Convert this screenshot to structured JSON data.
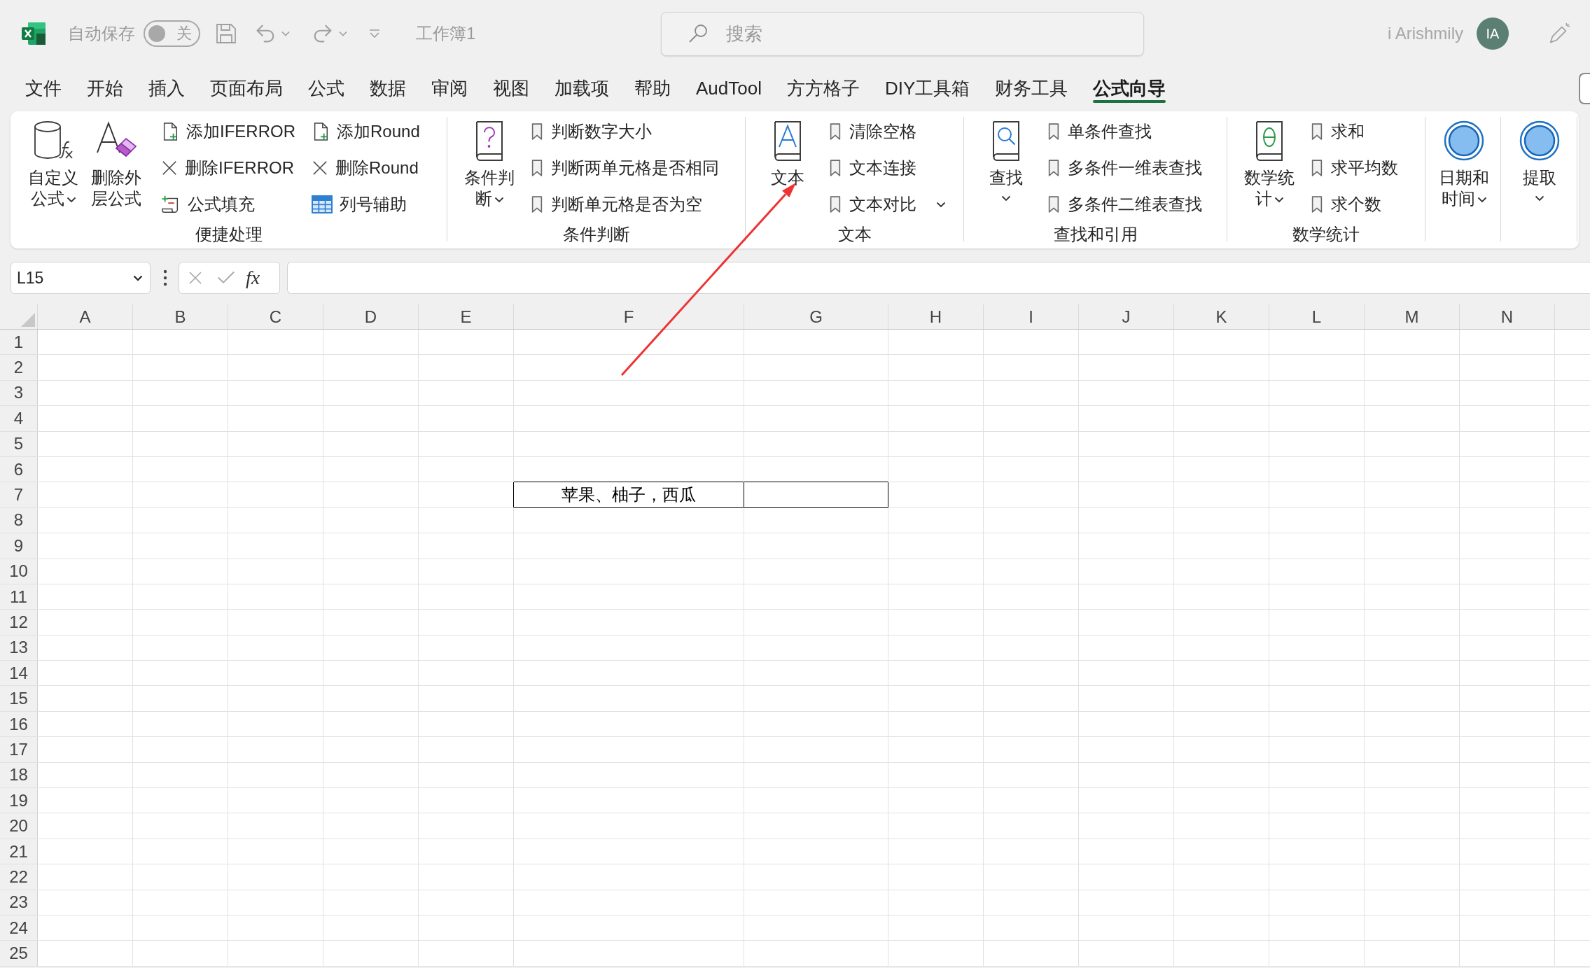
{
  "title_bar": {
    "autosave": {
      "label": "自动保存",
      "on": false,
      "state_text": "关"
    },
    "document_title": "工作簿1",
    "search": {
      "placeholder": "搜索"
    },
    "account": {
      "name": "i Arishmily",
      "initials": "IA"
    }
  },
  "ribbon_tabs": [
    {
      "label": "文件",
      "selected": false
    },
    {
      "label": "开始",
      "selected": false
    },
    {
      "label": "插入",
      "selected": false
    },
    {
      "label": "页面布局",
      "selected": false
    },
    {
      "label": "公式",
      "selected": false
    },
    {
      "label": "数据",
      "selected": false
    },
    {
      "label": "审阅",
      "selected": false
    },
    {
      "label": "视图",
      "selected": false
    },
    {
      "label": "加载项",
      "selected": false
    },
    {
      "label": "帮助",
      "selected": false
    },
    {
      "label": "AudTool",
      "selected": false
    },
    {
      "label": "方方格子",
      "selected": false
    },
    {
      "label": "DIY工具箱",
      "selected": false
    },
    {
      "label": "财务工具",
      "selected": false
    },
    {
      "label": "公式向导",
      "selected": true
    }
  ],
  "ribbon_groups": [
    {
      "label": "便捷处理",
      "items": [
        {
          "kind": "large",
          "label": "自定义公式",
          "has_menu": true
        },
        {
          "kind": "large",
          "label": "删除外层公式",
          "has_menu": false
        },
        {
          "kind": "stack",
          "buttons": [
            {
              "label": "添加IFERROR",
              "has_menu": false
            },
            {
              "label": "删除IFERROR",
              "has_menu": false
            },
            {
              "label": "公式填充",
              "has_menu": false
            }
          ]
        },
        {
          "kind": "stack",
          "buttons": [
            {
              "label": "添加Round",
              "has_menu": false
            },
            {
              "label": "删除Round",
              "has_menu": false
            },
            {
              "label": "列号辅助",
              "has_menu": false
            }
          ]
        }
      ]
    },
    {
      "label": "条件判断",
      "items": [
        {
          "kind": "large",
          "label": "条件判断",
          "has_menu": true
        },
        {
          "kind": "stack",
          "buttons": [
            {
              "label": "判断数字大小",
              "has_menu": false
            },
            {
              "label": "判断两单元格是否相同",
              "has_menu": false
            },
            {
              "label": "判断单元格是否为空",
              "has_menu": false
            }
          ]
        }
      ]
    },
    {
      "label": "文本",
      "items": [
        {
          "kind": "large",
          "label": "文本",
          "has_menu": false
        },
        {
          "kind": "stack",
          "buttons": [
            {
              "label": "清除空格",
              "has_menu": false
            },
            {
              "label": "文本连接",
              "has_menu": false
            },
            {
              "label": "文本对比",
              "has_menu": true
            }
          ]
        }
      ]
    },
    {
      "label": "查找和引用",
      "items": [
        {
          "kind": "large",
          "label": "查找",
          "has_menu": true
        },
        {
          "kind": "stack",
          "buttons": [
            {
              "label": "单条件查找",
              "has_menu": false
            },
            {
              "label": "多条件一维表查找",
              "has_menu": false
            },
            {
              "label": "多条件二维表查找",
              "has_menu": false
            }
          ]
        }
      ]
    },
    {
      "label": "数学统计",
      "items": [
        {
          "kind": "large",
          "label": "数学统计",
          "has_menu": true
        },
        {
          "kind": "stack",
          "buttons": [
            {
              "label": "求和",
              "has_menu": false
            },
            {
              "label": "求平均数",
              "has_menu": false
            },
            {
              "label": "求个数",
              "has_menu": false
            }
          ]
        }
      ]
    },
    {
      "items": [
        {
          "kind": "large",
          "label": "日期和时间",
          "has_menu": true
        }
      ]
    },
    {
      "items": [
        {
          "kind": "large",
          "label": "提取",
          "has_menu": true
        }
      ]
    }
  ],
  "formula_bar": {
    "name_box": "L15",
    "function_button": "fx"
  },
  "sheet": {
    "columns": [
      {
        "label": "A"
      },
      {
        "label": "B"
      },
      {
        "label": "C"
      },
      {
        "label": "D"
      },
      {
        "label": "E"
      },
      {
        "label": "F"
      },
      {
        "label": "G"
      },
      {
        "label": "H"
      },
      {
        "label": "I"
      },
      {
        "label": "J"
      },
      {
        "label": "K"
      },
      {
        "label": "L"
      },
      {
        "label": "M"
      },
      {
        "label": "N"
      }
    ],
    "rows": [
      {
        "label": "1"
      },
      {
        "label": "2"
      },
      {
        "label": "3"
      },
      {
        "label": "4"
      },
      {
        "label": "5"
      },
      {
        "label": "6"
      },
      {
        "label": "7",
        "cells": [
          {
            "bordered": false
          },
          {
            "bordered": false
          },
          {
            "bordered": false
          },
          {
            "bordered": false
          },
          {
            "bordered": false
          },
          {
            "bordered": true,
            "value": "苹果、柚子，西瓜"
          },
          {
            "bordered": true
          }
        ]
      },
      {
        "label": "8"
      },
      {
        "label": "9"
      },
      {
        "label": "10"
      },
      {
        "label": "11"
      },
      {
        "label": "12"
      },
      {
        "label": "13"
      },
      {
        "label": "14"
      },
      {
        "label": "15"
      },
      {
        "label": "16"
      },
      {
        "label": "17"
      },
      {
        "label": "18"
      },
      {
        "label": "19"
      },
      {
        "label": "20"
      },
      {
        "label": "21"
      },
      {
        "label": "22"
      },
      {
        "label": "23"
      },
      {
        "label": "24"
      },
      {
        "label": "25"
      }
    ]
  }
}
